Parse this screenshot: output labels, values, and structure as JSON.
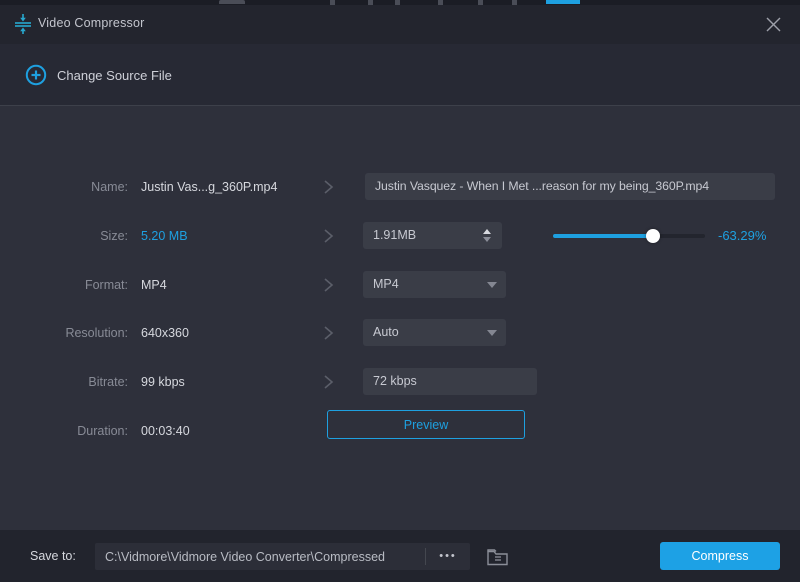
{
  "colors": {
    "accent": "#1ea0e0",
    "titlebar_bg": "#23252e",
    "content_bg": "#2e303b",
    "field_bg": "#3a3d47",
    "footer_bg": "#22242d"
  },
  "titlebar": {
    "title": "Video Compressor"
  },
  "header": {
    "change_source_label": "Change Source File"
  },
  "form": {
    "rows": [
      {
        "label": "Name:",
        "value": "Justin Vas...g_360P.mp4"
      },
      {
        "label": "Size:",
        "value": "5.20 MB"
      },
      {
        "label": "Format:",
        "value": "MP4"
      },
      {
        "label": "Resolution:",
        "value": "640x360"
      },
      {
        "label": "Bitrate:",
        "value": "99 kbps"
      },
      {
        "label": "Duration:",
        "value": "00:03:40"
      }
    ],
    "name_input": "Justin Vasquez - When I Met ...reason for my being_360P.mp4",
    "size_input": "1.91MB",
    "size_reduction": "-63.29%",
    "format_selected": "MP4",
    "resolution_selected": "Auto",
    "bitrate_input": "72 kbps",
    "preview_button": "Preview"
  },
  "footer": {
    "save_to_label": "Save to:",
    "save_path": "C:\\Vidmore\\Vidmore Video Converter\\Compressed",
    "more_button": "•••",
    "compress_button": "Compress"
  }
}
